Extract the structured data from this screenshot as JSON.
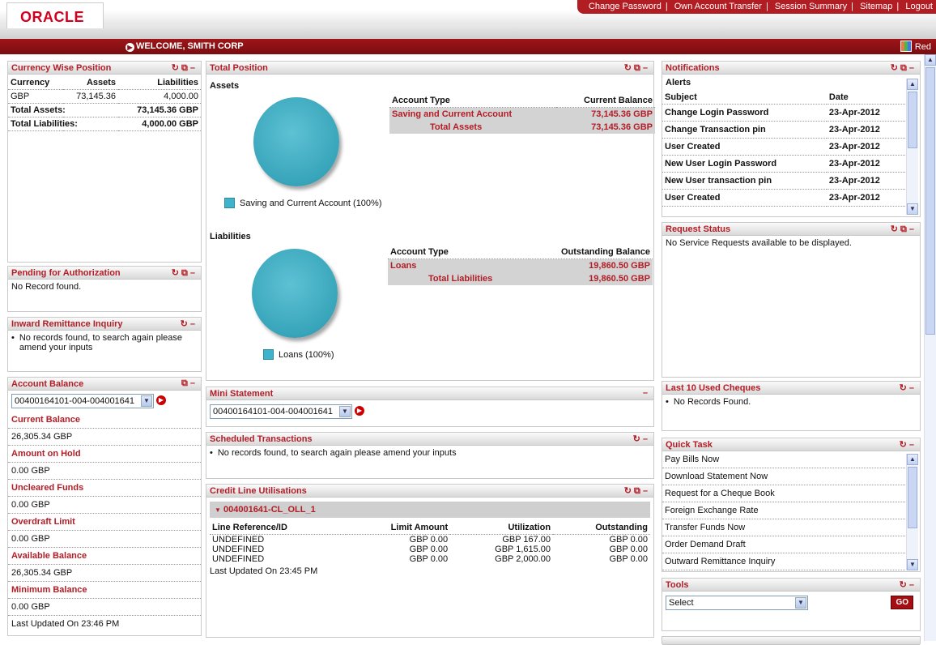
{
  "header": {
    "logo": "ORACLE",
    "links": [
      "Change Password",
      "Own Account Transfer",
      "Session Summary",
      "Sitemap",
      "Logout"
    ],
    "welcome": "WELCOME,  SMITH CORP",
    "theme": "Red"
  },
  "currency_position": {
    "title": "Currency Wise Position",
    "cols": [
      "Currency",
      "Assets",
      "Liabilities"
    ],
    "row": [
      "GBP",
      "73,145.36",
      "4,000.00"
    ],
    "total_assets_label": "Total Assets:",
    "total_assets_value": "73,145.36 GBP",
    "total_liabilities_label": "Total Liabilities:",
    "total_liabilities_value": "4,000.00 GBP"
  },
  "pending": {
    "title": "Pending for Authorization",
    "message": "No Record found."
  },
  "inward": {
    "title": "Inward Remittance Inquiry",
    "message": "No records found, to search again please amend your inputs"
  },
  "account_balance": {
    "title": "Account Balance",
    "account": "00400164101-004-004001641",
    "items": [
      {
        "label": "Current Balance",
        "value": "26,305.34  GBP"
      },
      {
        "label": "Amount on Hold",
        "value": "0.00  GBP"
      },
      {
        "label": "Uncleared Funds",
        "value": "0.00  GBP"
      },
      {
        "label": "Overdraft Limit",
        "value": "0.00  GBP"
      },
      {
        "label": "Available Balance",
        "value": "26,305.34  GBP"
      },
      {
        "label": "Minimum Balance",
        "value": "0.00  GBP"
      }
    ],
    "updated": "Last Updated On 23:46 PM"
  },
  "total_position": {
    "title": "Total Position",
    "assets_heading": "Assets",
    "assets_legend": "Saving and Current Account (100%)",
    "assets_table": {
      "cols": [
        "Account Type",
        "Current Balance"
      ],
      "row": [
        "Saving and Current Account",
        "73,145.36 GBP"
      ],
      "total": [
        "Total Assets",
        "73,145.36 GBP"
      ]
    },
    "liabilities_heading": "Liabilities",
    "liabilities_legend": "Loans (100%)",
    "liabilities_table": {
      "cols": [
        "Account Type",
        "Outstanding Balance"
      ],
      "row": [
        "Loans",
        "19,860.50 GBP"
      ],
      "total": [
        "Total Liabilities",
        "19,860.50 GBP"
      ]
    }
  },
  "mini_statement": {
    "title": "Mini Statement",
    "account": "00400164101-004-004001641"
  },
  "scheduled": {
    "title": "Scheduled Transactions",
    "message": "No records found, to search again please amend your inputs"
  },
  "credit_line": {
    "title": "Credit Line Utilisations",
    "group": "004001641-CL_OLL_1",
    "cols": [
      "Line Reference/ID",
      "Limit Amount",
      "Utilization",
      "Outstanding"
    ],
    "rows": [
      [
        "UNDEFINED",
        "GBP 0.00",
        "GBP 167.00",
        "GBP 0.00"
      ],
      [
        "UNDEFINED",
        "GBP 0.00",
        "GBP 1,615.00",
        "GBP 0.00"
      ],
      [
        "UNDEFINED",
        "GBP 0.00",
        "GBP 2,000.00",
        "GBP 0.00"
      ]
    ],
    "updated": "Last Updated On 23:45 PM"
  },
  "notifications": {
    "title": "Notifications",
    "section": "Alerts",
    "cols": [
      "Subject",
      "Date"
    ],
    "rows": [
      [
        "Change Login Password",
        "23-Apr-2012"
      ],
      [
        "Change Transaction pin",
        "23-Apr-2012"
      ],
      [
        "User Created",
        "23-Apr-2012"
      ],
      [
        "New User Login Password",
        "23-Apr-2012"
      ],
      [
        "New User transaction pin",
        "23-Apr-2012"
      ],
      [
        "User Created",
        "23-Apr-2012"
      ]
    ]
  },
  "request_status": {
    "title": "Request Status",
    "message": "No Service Requests available to be displayed."
  },
  "cheques": {
    "title": "Last 10 Used Cheques",
    "message": "No Records Found."
  },
  "quick_task": {
    "title": "Quick Task",
    "items": [
      "Pay Bills Now",
      "Download Statement Now",
      "Request for a Cheque Book",
      "Foreign Exchange Rate",
      "Transfer Funds Now",
      "Order Demand Draft",
      "Outward Remittance Inquiry"
    ]
  },
  "tools": {
    "title": "Tools",
    "select": "Select",
    "go": "GO"
  },
  "icons": {
    "refresh": "♲",
    "window": "❐",
    "minimize": "–"
  }
}
